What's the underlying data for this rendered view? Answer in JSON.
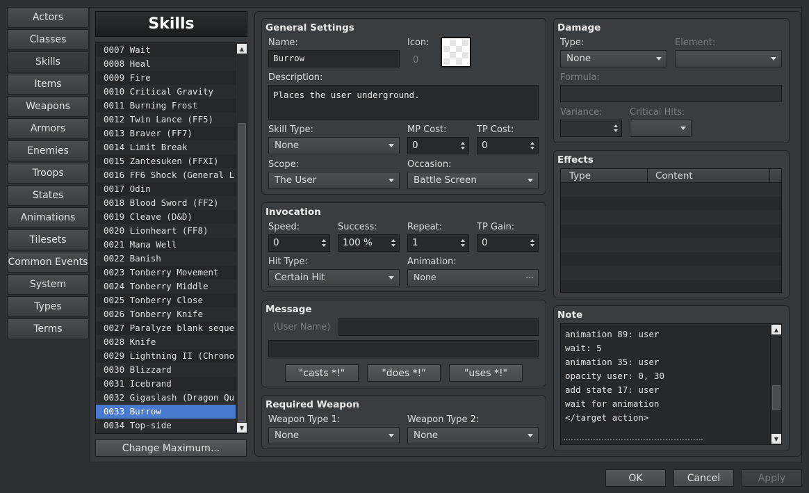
{
  "nav": {
    "items": [
      "Actors",
      "Classes",
      "Skills",
      "Items",
      "Weapons",
      "Armors",
      "Enemies",
      "Troops",
      "States",
      "Animations",
      "Tilesets",
      "Common Events",
      "System",
      "Types",
      "Terms"
    ],
    "active": "Skills"
  },
  "list": {
    "title": "Skills",
    "items": [
      "0007 Wait",
      "0008 Heal",
      "0009 Fire",
      "0010 Critical Gravity",
      "0011 Burning Frost",
      "0012 Twin Lance (FF5)",
      "0013 Braver (FF7)",
      "0014 Limit Break",
      "0015 Zantesuken (FFXI)",
      "0016 FF6 Shock (General L···",
      "0017 Odin",
      "0018 Blood Sword (FF2)",
      "0019 Cleave (D&D)",
      "0020 Lionheart (FF8)",
      "0021 Mana Well",
      "0022 Banish",
      "0023 Tonberry Movement",
      "0024 Tonberry Middle",
      "0025 Tonberry Close",
      "0026 Tonberry Knife",
      "0027 Paralyze blank seque···",
      "0028 Knife",
      "0029 Lightning II (Chrono···",
      "0030 Blizzard",
      "0031 Icebrand",
      "0032 Gigaslash (Dragon Qu···",
      "0033 Burrow",
      "0034 Top-side"
    ],
    "selected": "0033 Burrow",
    "change_max_label": "Change Maximum..."
  },
  "general": {
    "title": "General Settings",
    "name_label": "Name:",
    "name_value": "Burrow",
    "icon_label": "Icon:",
    "icon_value": "0",
    "desc_label": "Description:",
    "desc_value": "Places the user underground.",
    "skill_type_label": "Skill Type:",
    "skill_type_value": "None",
    "mp_label": "MP Cost:",
    "mp_value": "0",
    "tp_label": "TP Cost:",
    "tp_value": "0",
    "scope_label": "Scope:",
    "scope_value": "The User",
    "occasion_label": "Occasion:",
    "occasion_value": "Battle Screen"
  },
  "invocation": {
    "title": "Invocation",
    "speed_label": "Speed:",
    "speed_value": "0",
    "success_label": "Success:",
    "success_value": "100 %",
    "repeat_label": "Repeat:",
    "repeat_value": "1",
    "tpgain_label": "TP Gain:",
    "tpgain_value": "0",
    "hittype_label": "Hit Type:",
    "hittype_value": "Certain Hit",
    "animation_label": "Animation:",
    "animation_value": "None",
    "animation_more": "···"
  },
  "message": {
    "title": "Message",
    "user_name": "(User Name)",
    "btn_casts": "\"casts *!\"",
    "btn_does": "\"does *!\"",
    "btn_uses": "\"uses *!\""
  },
  "weapon": {
    "title": "Required Weapon",
    "type1_label": "Weapon Type 1:",
    "type1_value": "None",
    "type2_label": "Weapon Type 2:",
    "type2_value": "None"
  },
  "damage": {
    "title": "Damage",
    "type_label": "Type:",
    "type_value": "None",
    "element_label": "Element:",
    "formula_label": "Formula:",
    "variance_label": "Variance:",
    "crit_label": "Critical Hits:"
  },
  "effects": {
    "title": "Effects",
    "col_type": "Type",
    "col_content": "Content"
  },
  "note": {
    "title": "Note",
    "lines": [
      "animation 89: user",
      "wait: 5",
      "animation 35: user",
      "opacity user: 0, 30",
      "add state 17: user",
      "wait for animation",
      "</target action>"
    ]
  },
  "footer": {
    "ok": "OK",
    "cancel": "Cancel",
    "apply": "Apply"
  }
}
